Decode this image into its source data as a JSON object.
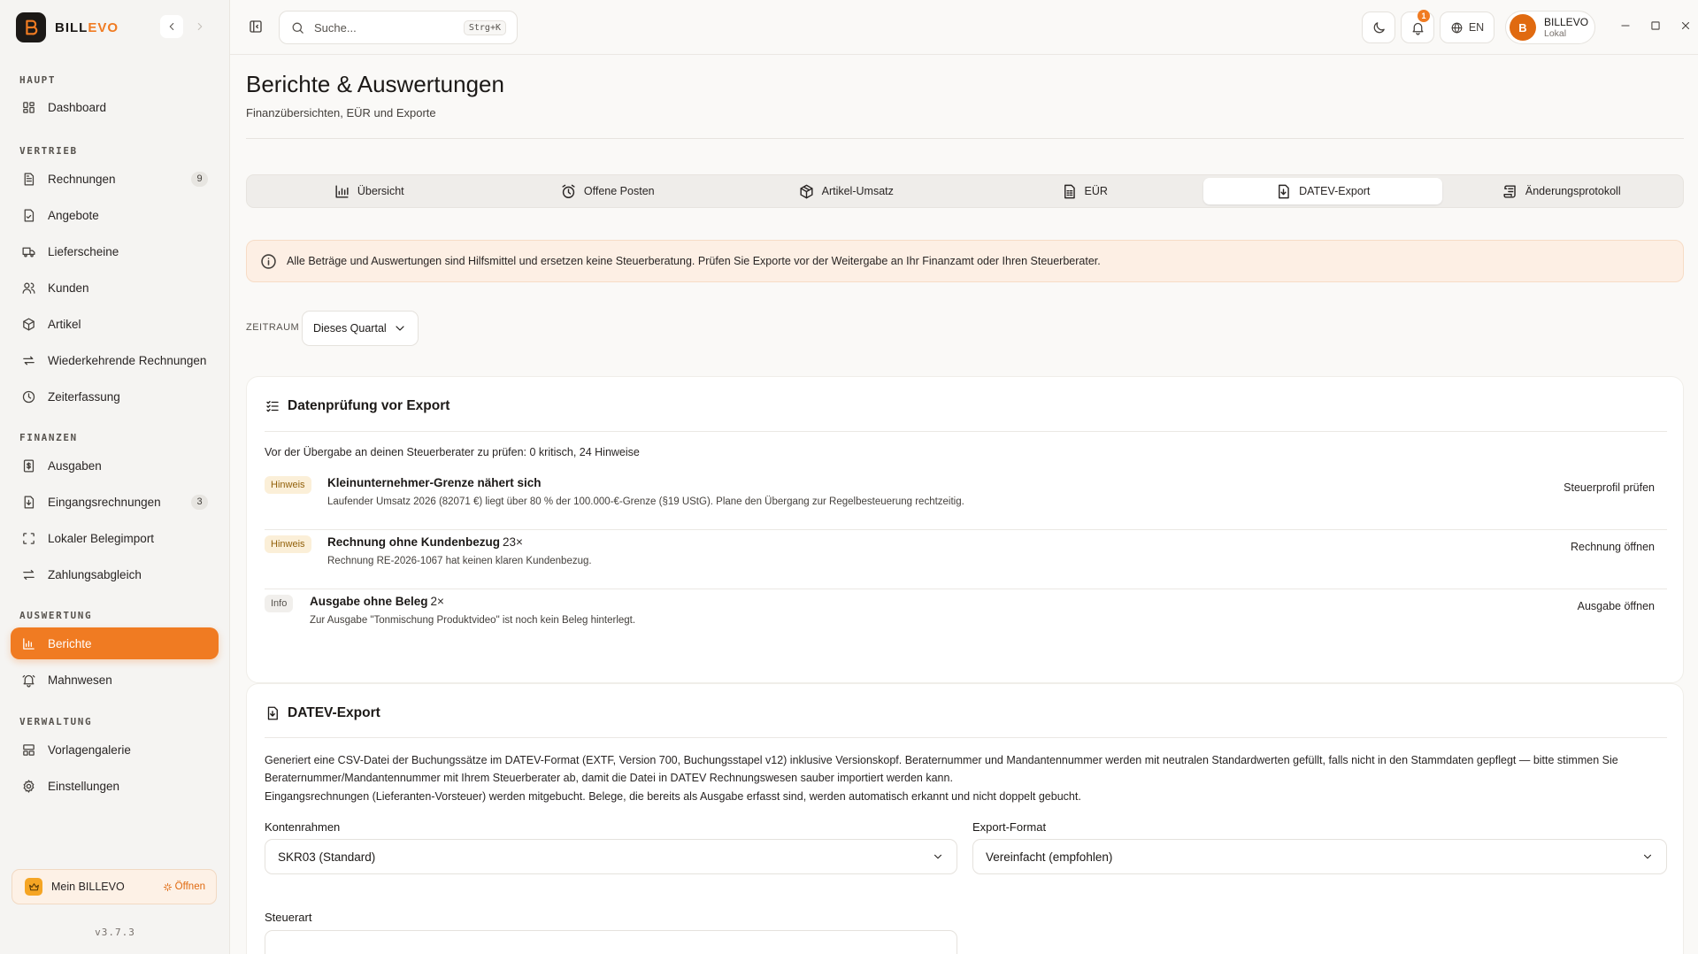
{
  "app": {
    "brand_main": "BILL",
    "brand_accent": "EVO",
    "accent_color": "#f07b22"
  },
  "sidebar": {
    "sections": {
      "haupt": "HAUPT",
      "vertrieb": "VERTRIEB",
      "finanzen": "FINANZEN",
      "auswertung": "AUSWERTUNG",
      "verwaltung": "VERWALTUNG"
    },
    "items": {
      "dashboard": "Dashboard",
      "rechnungen": "Rechnungen",
      "rechnungen_badge": "9",
      "angebote": "Angebote",
      "lieferscheine": "Lieferscheine",
      "kunden": "Kunden",
      "artikel": "Artikel",
      "wiederkehrend": "Wiederkehrende Rechnungen",
      "zeiterfassung": "Zeiterfassung",
      "ausgaben": "Ausgaben",
      "eingangsrechnungen": "Eingangsrechnungen",
      "eingangsrechnungen_badge": "3",
      "belegimport": "Lokaler Belegimport",
      "zahlungsabgleich": "Zahlungsabgleich",
      "berichte": "Berichte",
      "mahnwesen": "Mahnwesen",
      "vorlagengalerie": "Vorlagengalerie",
      "einstellungen": "Einstellungen"
    },
    "mein": {
      "label": "Mein BILLEVO",
      "open": "Öffnen"
    },
    "version": "v3.7.3"
  },
  "topbar": {
    "search_placeholder": "Suche...",
    "search_shortcut": "Strg+K",
    "notification_count": "1",
    "language": "EN",
    "user_initial": "B",
    "user_name": "BILLEVO",
    "user_sub": "Lokal"
  },
  "page": {
    "title": "Berichte & Auswertungen",
    "subtitle": "Finanzübersichten, EÜR und Exporte",
    "tabs": {
      "overview": "Übersicht",
      "open_items": "Offene Posten",
      "article_revenue": "Artikel-Umsatz",
      "eur": "EÜR",
      "datev": "DATEV-Export",
      "changelog": "Änderungsprotokoll"
    },
    "notice": "Alle Beträge und Auswertungen sind Hilfsmittel und ersetzen keine Steuerberatung. Prüfen Sie Exporte vor der Weitergabe an Ihr Finanzamt oder Ihren Steuerberater.",
    "period_label": "ZEITRAUM",
    "period_value": "Dieses Quartal"
  },
  "check": {
    "title": "Datenprüfung vor Export",
    "summary": "Vor der Übergabe an deinen Steuerberater zu prüfen: 0 kritisch, 24 Hinweise",
    "issues": [
      {
        "tag": "Hinweis",
        "title": "Kleinunternehmer-Grenze nähert sich",
        "count": "",
        "desc": "Laufender Umsatz 2026 (82071 €) liegt über 80 % der 100.000-€-Grenze (§19 UStG). Plane den Übergang zur Regelbesteuerung rechtzeitig.",
        "action": "Steuerprofil prüfen"
      },
      {
        "tag": "Hinweis",
        "title": "Rechnung ohne Kundenbezug",
        "count": "23×",
        "desc": "Rechnung RE-2026-1067 hat keinen klaren Kundenbezug.",
        "action": "Rechnung öffnen"
      },
      {
        "tag": "Info",
        "title": "Ausgabe ohne Beleg",
        "count": "2×",
        "desc": "Zur Ausgabe \"Tonmischung Produktvideo\" ist noch kein Beleg hinterlegt.",
        "action": "Ausgabe öffnen"
      }
    ]
  },
  "datev": {
    "title": "DATEV-Export",
    "desc1": "Generiert eine CSV-Datei der Buchungssätze im DATEV-Format (EXTF, Version 700, Buchungsstapel v12) inklusive Versionskopf. Beraternummer und Mandantennummer werden mit neutralen Standardwerten gefüllt, falls nicht in den Stammdaten gepflegt — bitte stimmen Sie Beraternummer/Mandantennummer mit Ihrem Steuerberater ab, damit die Datei in DATEV Rechnungswesen sauber importiert werden kann.",
    "desc2": "Eingangsrechnungen (Lieferanten-Vorsteuer) werden mitgebucht. Belege, die bereits als Ausgabe erfasst sind, werden automatisch erkannt und nicht doppelt gebucht.",
    "kontenrahmen_label": "Kontenrahmen",
    "kontenrahmen_value": "SKR03 (Standard)",
    "format_label": "Export-Format",
    "format_value": "Vereinfacht (empfohlen)",
    "steuerart_label": "Steuerart"
  }
}
